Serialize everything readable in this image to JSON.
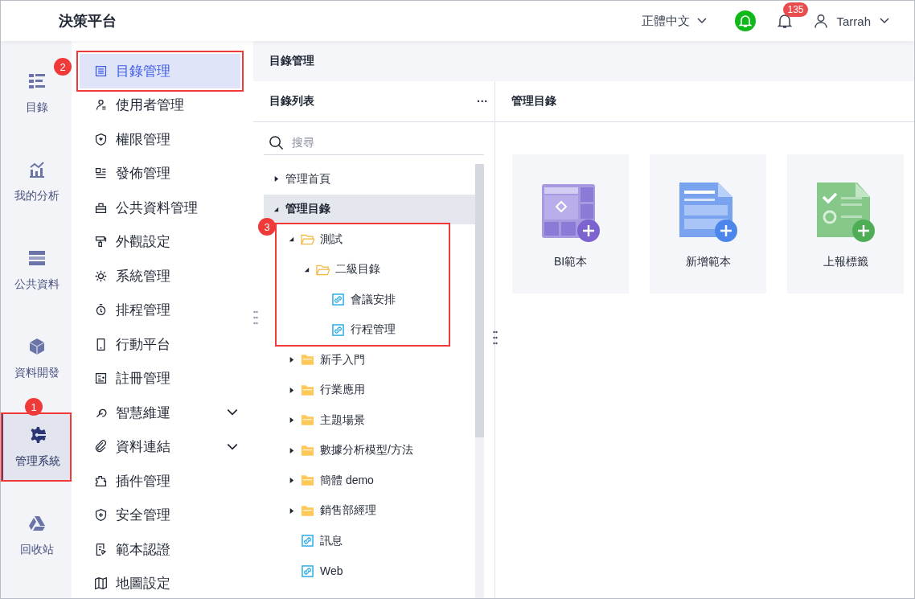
{
  "header": {
    "title": "決策平台",
    "language": "正體中文",
    "notification_badge": "135",
    "user": "Tarrah"
  },
  "rail": [
    {
      "label": "目錄",
      "selected": false
    },
    {
      "label": "我的分析",
      "selected": false
    },
    {
      "label": "公共資料",
      "selected": false
    },
    {
      "label": "資料開發",
      "selected": false
    },
    {
      "label": "管理系統",
      "selected": true,
      "callout": "1"
    },
    {
      "label": "回收站",
      "selected": false
    }
  ],
  "menu": [
    {
      "label": "目錄管理",
      "kind": "item",
      "selected": true,
      "callout": "2"
    },
    {
      "label": "使用者管理",
      "kind": "item",
      "selected": false
    },
    {
      "label": "權限管理",
      "kind": "item",
      "selected": false
    },
    {
      "label": "發佈管理",
      "kind": "item",
      "selected": false
    },
    {
      "label": "公共資料管理",
      "kind": "item",
      "selected": false
    },
    {
      "label": "外觀設定",
      "kind": "item",
      "selected": false
    },
    {
      "label": "系統管理",
      "kind": "item",
      "selected": false
    },
    {
      "label": "排程管理",
      "kind": "item",
      "selected": false
    },
    {
      "label": "行動平台",
      "kind": "item",
      "selected": false
    },
    {
      "label": "註冊管理",
      "kind": "item",
      "selected": false
    },
    {
      "label": "智慧維運",
      "kind": "group",
      "selected": false,
      "expanded": false
    },
    {
      "label": "資料連結",
      "kind": "group",
      "selected": false,
      "expanded": false
    },
    {
      "label": "插件管理",
      "kind": "item",
      "selected": false
    },
    {
      "label": "安全管理",
      "kind": "item",
      "selected": false
    },
    {
      "label": "範本認證",
      "kind": "item",
      "selected": false
    },
    {
      "label": "地圖設定",
      "kind": "item",
      "selected": false
    }
  ],
  "breadcrumb": "目錄管理",
  "tree_panel": {
    "title": "目錄列表",
    "more_glyph": "···",
    "search": {
      "placeholder": "搜尋"
    },
    "nodes": [
      {
        "label": "管理首頁",
        "kind": "root",
        "expanded": false,
        "selected": false
      },
      {
        "label": "管理目錄",
        "kind": "root",
        "expanded": true,
        "selected": true,
        "children": [
          {
            "label": "測試",
            "kind": "folder",
            "expanded": true,
            "selected": false,
            "callout": "3",
            "children": [
              {
                "label": "二級目錄",
                "kind": "folder",
                "expanded": true,
                "selected": false,
                "children": [
                  {
                    "label": "會議安排",
                    "kind": "link",
                    "selected": false
                  },
                  {
                    "label": "行程管理",
                    "kind": "link",
                    "selected": false
                  }
                ]
              }
            ]
          },
          {
            "label": "新手入門",
            "kind": "folder",
            "expanded": false,
            "selected": false
          },
          {
            "label": "行業應用",
            "kind": "folder",
            "expanded": false,
            "selected": false
          },
          {
            "label": "主題場景",
            "kind": "folder",
            "expanded": false,
            "selected": false
          },
          {
            "label": "數據分析模型/方法",
            "kind": "folder",
            "expanded": false,
            "selected": false
          },
          {
            "label": "簡體 demo",
            "kind": "folder",
            "expanded": false,
            "selected": false
          },
          {
            "label": "銷售部經理",
            "kind": "folder",
            "expanded": false,
            "selected": false
          },
          {
            "label": "訊息",
            "kind": "link",
            "selected": false
          },
          {
            "label": "Web",
            "kind": "link",
            "selected": false
          }
        ]
      }
    ]
  },
  "content": {
    "title": "管理目錄",
    "cards": [
      {
        "label": "BI範本",
        "kind": "bi"
      },
      {
        "label": "新增範本",
        "kind": "document"
      },
      {
        "label": "上報標籤",
        "kind": "report"
      }
    ]
  }
}
